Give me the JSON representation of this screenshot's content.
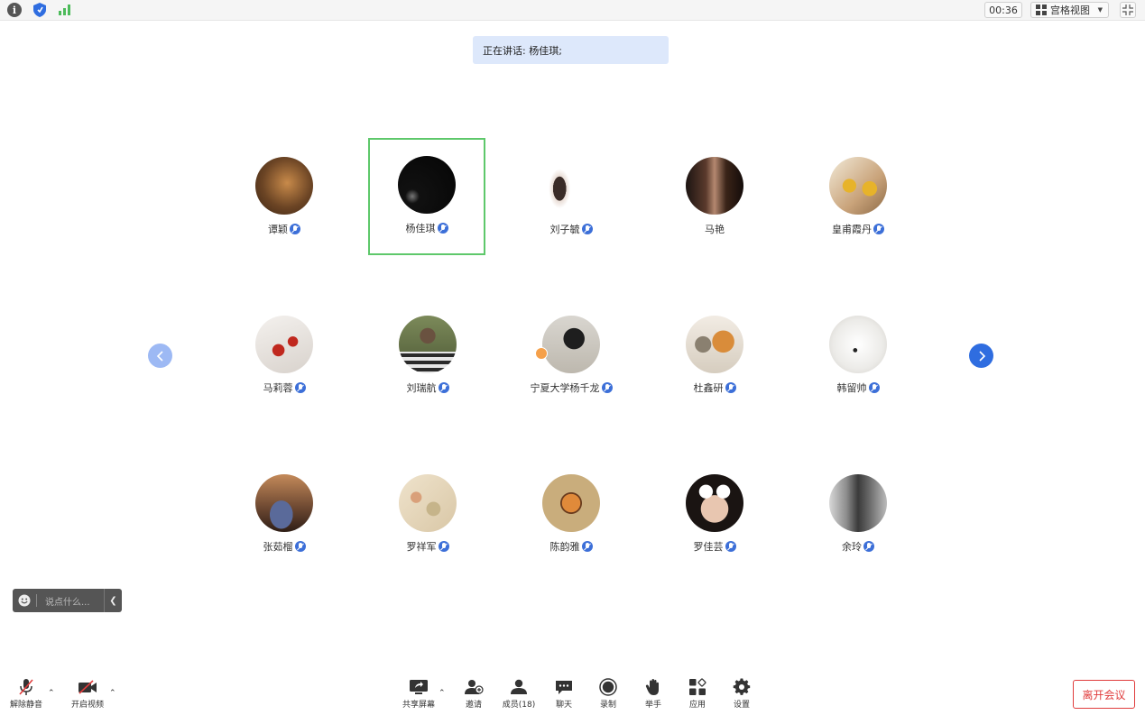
{
  "topbar": {
    "timer": "00:36",
    "view_mode": "宫格视图",
    "icons": [
      "info-icon",
      "shield-icon",
      "signal-icon",
      "grid-view-icon",
      "exit-fullscreen-icon"
    ]
  },
  "speaking_banner": "正在讲话: 杨佳琪;",
  "participants": [
    {
      "name": "谭颖",
      "mic": true
    },
    {
      "name": "杨佳琪",
      "mic": true,
      "active_speaker": true
    },
    {
      "name": "刘子毓",
      "mic": true
    },
    {
      "name": "马艳",
      "mic": false
    },
    {
      "name": "皇甫霞丹",
      "mic": true
    },
    {
      "name": "马莉蓉",
      "mic": true
    },
    {
      "name": "刘瑞航",
      "mic": true
    },
    {
      "name": "宁夏大学杨千龙",
      "mic": true,
      "host": true
    },
    {
      "name": "杜鑫研",
      "mic": true
    },
    {
      "name": "韩留帅",
      "mic": true
    },
    {
      "name": "张茹榴",
      "mic": true
    },
    {
      "name": "罗祥军",
      "mic": true
    },
    {
      "name": "陈韵雅",
      "mic": true
    },
    {
      "name": "罗佳芸",
      "mic": true
    },
    {
      "name": "余玲",
      "mic": true
    }
  ],
  "chat": {
    "placeholder": "说点什么..."
  },
  "toolbar": {
    "unmute": "解除静音",
    "start_video": "开启视频",
    "share_screen": "共享屏幕",
    "invite": "邀请",
    "members": "成员(18)",
    "chat": "聊天",
    "record": "录制",
    "raise_hand": "举手",
    "apps": "应用",
    "settings": "设置",
    "leave": "离开会议"
  },
  "colors": {
    "active_border": "#5ec86b",
    "banner_bg": "#dde8fb",
    "nav_next": "#2f6de0",
    "nav_prev": "#9db9f4",
    "leave": "#e03c3c",
    "mic_badge": "#3c6fd8"
  }
}
